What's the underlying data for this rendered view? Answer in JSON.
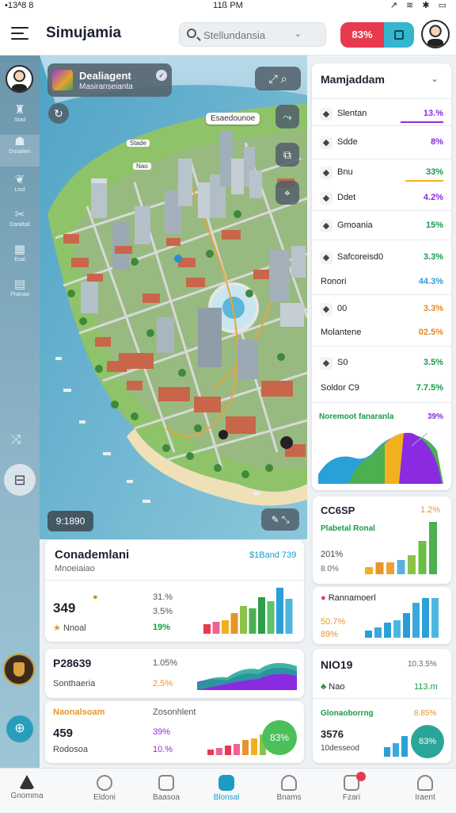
{
  "status": {
    "left": "•13ᴬ8 8",
    "time": "11ß PM",
    "right": "↗ ≋ ✱ ▭"
  },
  "header": {
    "title": "Simujamia",
    "search_placeholder": "Stellundansia",
    "pill_value": "83%"
  },
  "rail": {
    "items": [
      {
        "icon": "hat-icon",
        "label": "Stad"
      },
      {
        "icon": "people-icon",
        "label": "Dosalien"
      },
      {
        "icon": "bird-icon",
        "label": "Liod"
      },
      {
        "icon": "wrench-icon",
        "label": "Daraltail"
      },
      {
        "icon": "grid-icon",
        "label": "Esal"
      },
      {
        "icon": "card-icon",
        "label": "Fhanaa"
      }
    ]
  },
  "map": {
    "card_title": "Dealiagent",
    "card_sub": "Masiranseianta",
    "tooltip": "Esaedounoe",
    "label_1": "Stade",
    "label_2": "Nao",
    "readout": "9:1890"
  },
  "summary": {
    "title": "Mamjaddam",
    "rows": [
      {
        "icon": "coin-icon",
        "label": "Slentan",
        "value": "13.%",
        "value_color": "#8a2be2",
        "bar": 0.9,
        "bar_color": "#8a2be2"
      },
      {
        "icon": "leaf-icon",
        "label": "Sdde",
        "value": "8%",
        "value_color": "#8a2be2"
      },
      {
        "icon": "drop-icon",
        "label": "Bnu",
        "value": "33%",
        "value_color": "#1a9a48",
        "bar": 0.8,
        "bar_color": "#f2b01e"
      },
      {
        "icon": "ship-icon",
        "label": "Ddet",
        "value": "4.2%",
        "value_color": "#8a2be2"
      },
      {
        "icon": "list-icon",
        "label": "Gmoania",
        "value": "15%",
        "value_color": "#1a9a48"
      },
      {
        "icon": "robot-icon",
        "label": "Safcoreisd0",
        "value": "3.3%",
        "value_color": "#1a9a48"
      },
      {
        "icon": "",
        "label": "Ronori",
        "value": "44.3%",
        "value_color": "#2aa0d8"
      },
      {
        "icon": "box-icon",
        "label": "00",
        "value": "3.3%",
        "value_color": "#e88a20"
      },
      {
        "icon": "",
        "label": "Molantene",
        "value": "02.5%",
        "value_color": "#e88a20"
      },
      {
        "icon": "handshake-icon",
        "label": "S0",
        "value": "3.5%",
        "value_color": "#1a9a48"
      },
      {
        "icon": "",
        "label": "Soldor C9",
        "value": "7.7.5%",
        "value_color": "#1a9a48"
      }
    ],
    "area_title": "Noremoot fanaranla",
    "area_value": "39%"
  },
  "cards": {
    "c1": {
      "title": "Conademlani",
      "sub": "Mnoeiaiao",
      "tag": "$1Band 739",
      "big": "349",
      "small": "Nnoal",
      "p1": "31.%",
      "p2": "3.5%",
      "p3": "19%",
      "bars": [
        {
          "v": 4,
          "c": "#e8394f"
        },
        {
          "v": 5,
          "c": "#f06292"
        },
        {
          "v": 6,
          "c": "#f2b01e"
        },
        {
          "v": 9,
          "c": "#e8942a"
        },
        {
          "v": 12,
          "c": "#8bc34a"
        },
        {
          "v": 11,
          "c": "#4caf50"
        },
        {
          "v": 16,
          "c": "#2e9e48"
        },
        {
          "v": 14,
          "c": "#5bc36a"
        },
        {
          "v": 20,
          "c": "#2aa0d8"
        },
        {
          "v": 15,
          "c": "#4db6e0"
        }
      ]
    },
    "c2": {
      "title": "CC6SP",
      "value": "1.2%",
      "sub": "Plabetal Ronal",
      "pct": "201%",
      "pct2": "8.0%",
      "bars": [
        {
          "v": 3,
          "c": "#f2b01e"
        },
        {
          "v": 5,
          "c": "#e8942a"
        },
        {
          "v": 5,
          "c": "#f0a030"
        },
        {
          "v": 6,
          "c": "#5bb0e0"
        },
        {
          "v": 8,
          "c": "#8bc34a"
        },
        {
          "v": 14,
          "c": "#6abf45"
        },
        {
          "v": 22,
          "c": "#4caf50"
        }
      ]
    },
    "c3": {
      "title": "Rannamoerl",
      "pct": "50.7%",
      "pct2": "89%",
      "bars": [
        {
          "v": 3,
          "c": "#2aa0d8"
        },
        {
          "v": 4,
          "c": "#3aa8dc"
        },
        {
          "v": 6,
          "c": "#2aa0d8"
        },
        {
          "v": 7,
          "c": "#4db6e0"
        },
        {
          "v": 10,
          "c": "#2a9cd4"
        },
        {
          "v": 14,
          "c": "#3aa8dc"
        },
        {
          "v": 16,
          "c": "#2aa0d8"
        },
        {
          "v": 16,
          "c": "#4db6e0"
        }
      ]
    },
    "c4": {
      "title": "P28639",
      "pct": "1.05%",
      "sub": "Sonthaeria",
      "pct2": "2.5%"
    },
    "c5": {
      "title": "Naonalsoam",
      "sub": "Zosonhlent",
      "big": "459",
      "small": "Rodosoa",
      "p1": "39%",
      "p2": "10.%",
      "ring": "83%",
      "bars": [
        {
          "v": 3,
          "c": "#e8394f"
        },
        {
          "v": 4,
          "c": "#f06292"
        },
        {
          "v": 5,
          "c": "#e8394f"
        },
        {
          "v": 6,
          "c": "#f06292"
        },
        {
          "v": 8,
          "c": "#e8942a"
        },
        {
          "v": 9,
          "c": "#f2b01e"
        },
        {
          "v": 11,
          "c": "#8bc34a"
        }
      ]
    },
    "c6": {
      "title": "NIO19",
      "pct": "10.3.5%",
      "sub": "Nao",
      "val": "113.m",
      "sub2": "Glonaoborrng",
      "val2": "8.85%",
      "big": "3576",
      "small": "10desseod",
      "ring": "83%",
      "bars": [
        {
          "v": 4,
          "c": "#2aa0d8"
        },
        {
          "v": 6,
          "c": "#3aa8dc"
        },
        {
          "v": 9,
          "c": "#2aa0d8"
        }
      ]
    }
  },
  "bottomnav": [
    {
      "icon": "home-icon",
      "label": "Gnomma"
    },
    {
      "icon": "leaf-icon",
      "label": "Eldoni"
    },
    {
      "icon": "board-icon",
      "label": "Baasoa"
    },
    {
      "icon": "house-icon",
      "label": "Blonsal"
    },
    {
      "icon": "person-icon",
      "label": "Bnams"
    },
    {
      "icon": "mail-icon",
      "label": "Fzari"
    },
    {
      "icon": "user-icon",
      "label": "Iraent"
    }
  ]
}
